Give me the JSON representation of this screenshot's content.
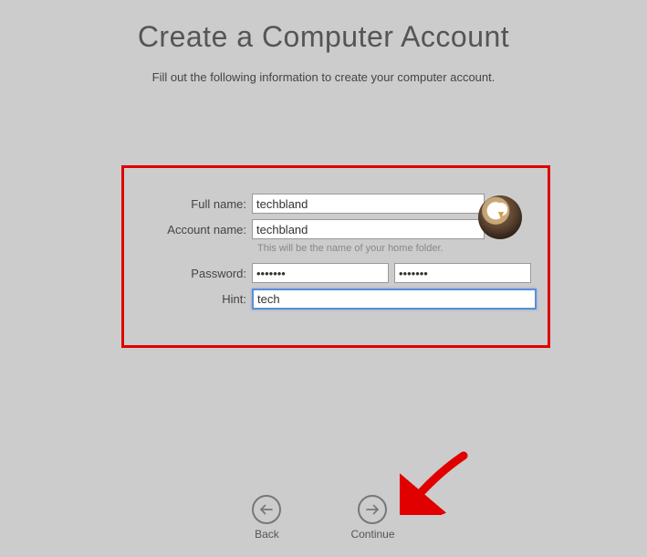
{
  "title": "Create a Computer Account",
  "subtitle": "Fill out the following information to create your computer account.",
  "labels": {
    "full_name": "Full name:",
    "account_name": "Account name:",
    "password": "Password:",
    "hint": "Hint:"
  },
  "values": {
    "full_name": "techbland",
    "account_name": "techbland",
    "password": "•••••••",
    "password_confirm": "•••••••",
    "hint": "tech"
  },
  "helper": {
    "account_name": "This will be the name of your home folder."
  },
  "nav": {
    "back": "Back",
    "continue": "Continue"
  },
  "avatar": {
    "name": "eagle"
  }
}
